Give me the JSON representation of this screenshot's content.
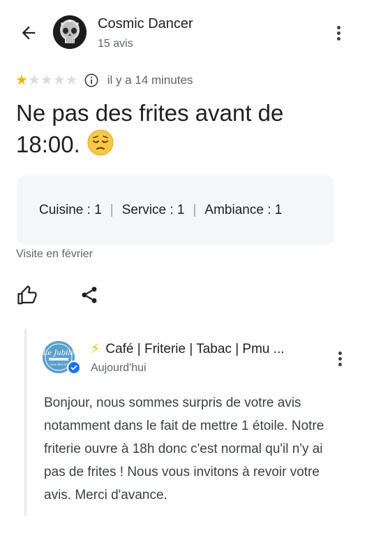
{
  "header": {
    "user_name": "Cosmic Dancer",
    "review_count": "15 avis"
  },
  "review": {
    "rating": 1,
    "max_rating": 5,
    "time": "il y a 14 minutes",
    "title": "Ne pas des frites avant de 18:00.",
    "emoji": "😔",
    "sub_ratings": [
      {
        "label": "Cuisine : 1"
      },
      {
        "label": "Service : 1"
      },
      {
        "label": "Ambiance : 1"
      }
    ],
    "visit": "Visite en février"
  },
  "owner_reply": {
    "name": "Café | Friterie | Tabac | Pmu ...",
    "bolt": "⚡",
    "date": "Aujourd'hui",
    "text": "Bonjour, nous sommes surpris de votre avis notamment dans le fait de mettre 1 étoile. Notre friterie ouvre à 18h donc c'est normal qu'il n'y ai pas de frites ! Nous vous invitons à revoir votre avis. Merci d'avance."
  },
  "colors": {
    "star_filled": "#f4b400",
    "star_empty": "#dadce0",
    "verified": "#1a73e8",
    "text_secondary": "#5f6368"
  },
  "icons": [
    "arrow-back-icon",
    "more-vert-icon",
    "info-icon",
    "thumb-up-icon",
    "share-icon",
    "verified-icon"
  ]
}
